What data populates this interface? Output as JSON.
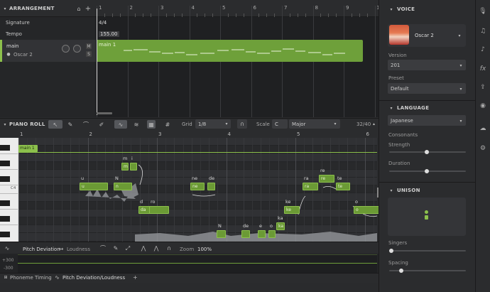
{
  "arrangement": {
    "title": "ARRANGEMENT",
    "signature_label": "Signature",
    "signature_value": "4/4",
    "tempo_label": "Tempo",
    "tempo_value": "155.00",
    "track_name": "main",
    "track_singer": "Oscar 2",
    "mute_label": "M",
    "solo_label": "S",
    "clip_name": "main 1",
    "bars": [
      "1",
      "2",
      "3",
      "4",
      "5",
      "6",
      "7",
      "8",
      "9",
      "10"
    ]
  },
  "piano_roll": {
    "title": "PIANO ROLL",
    "grid_label": "Grid",
    "grid_value": "1/8",
    "scale_label": "Scale",
    "scale_key": "C",
    "scale_mode": "Major",
    "counter": "32/40",
    "clip_name": "main 1",
    "c4_label": "C4",
    "bars": [
      "1",
      "2",
      "3",
      "4",
      "5",
      "6"
    ]
  },
  "notes": [
    {
      "lyric": "m",
      "sub": "m",
      "pitch_row": 0
    },
    {
      "lyric": "i",
      "sub": "",
      "pitch_row": 0
    },
    {
      "lyric": "u",
      "sub": "u",
      "pitch_row": 2
    },
    {
      "lyric": "N",
      "sub": "n",
      "pitch_row": 2
    },
    {
      "lyric": "d",
      "sub": "da",
      "pitch_row": 5
    },
    {
      "lyric": "ro",
      "sub": "",
      "pitch_row": 5
    },
    {
      "lyric": "ne",
      "sub": "ne",
      "pitch_row": 2
    },
    {
      "lyric": "de",
      "sub": "",
      "pitch_row": 2
    },
    {
      "lyric": "N",
      "sub": "",
      "pitch_row": 8
    },
    {
      "lyric": "de",
      "sub": "",
      "pitch_row": 8
    },
    {
      "lyric": "e",
      "sub": "",
      "pitch_row": 8
    },
    {
      "lyric": "o",
      "sub": "",
      "pitch_row": 8
    },
    {
      "lyric": "ka",
      "sub": "ka",
      "pitch_row": 7
    },
    {
      "lyric": "ke",
      "sub": "ke",
      "pitch_row": 5
    },
    {
      "lyric": "ra",
      "sub": "ra",
      "pitch_row": 2
    },
    {
      "lyric": "re",
      "sub": "re",
      "pitch_row": 1
    },
    {
      "lyric": "te",
      "sub": "te",
      "pitch_row": 2
    },
    {
      "lyric": "o",
      "sub": "o",
      "pitch_row": 5
    }
  ],
  "param": {
    "name": "Pitch Deviation",
    "alt": "Loudness",
    "zoom_label": "Zoom",
    "zoom_value": "100%",
    "top_label": "+300",
    "bottom_label": "-300"
  },
  "bottom_tabs": {
    "phoneme": "Phoneme Timing",
    "pitch": "Pitch Deviation/Loudness",
    "add": "+"
  },
  "voice": {
    "title": "VOICE",
    "singer": "Oscar 2",
    "version_label": "Version",
    "version_value": "201",
    "preset_label": "Preset",
    "preset_value": "Default"
  },
  "language": {
    "title": "LANGUAGE",
    "value": "Japanese",
    "consonants_label": "Consonants",
    "strength_label": "Strength",
    "duration_label": "Duration"
  },
  "unison": {
    "title": "UNISON",
    "singers_label": "Singers",
    "spacing_label": "Spacing"
  },
  "colors": {
    "accent": "#8cc04c",
    "note_fill": "#6b9a35",
    "bg": "#2a2b2d"
  }
}
